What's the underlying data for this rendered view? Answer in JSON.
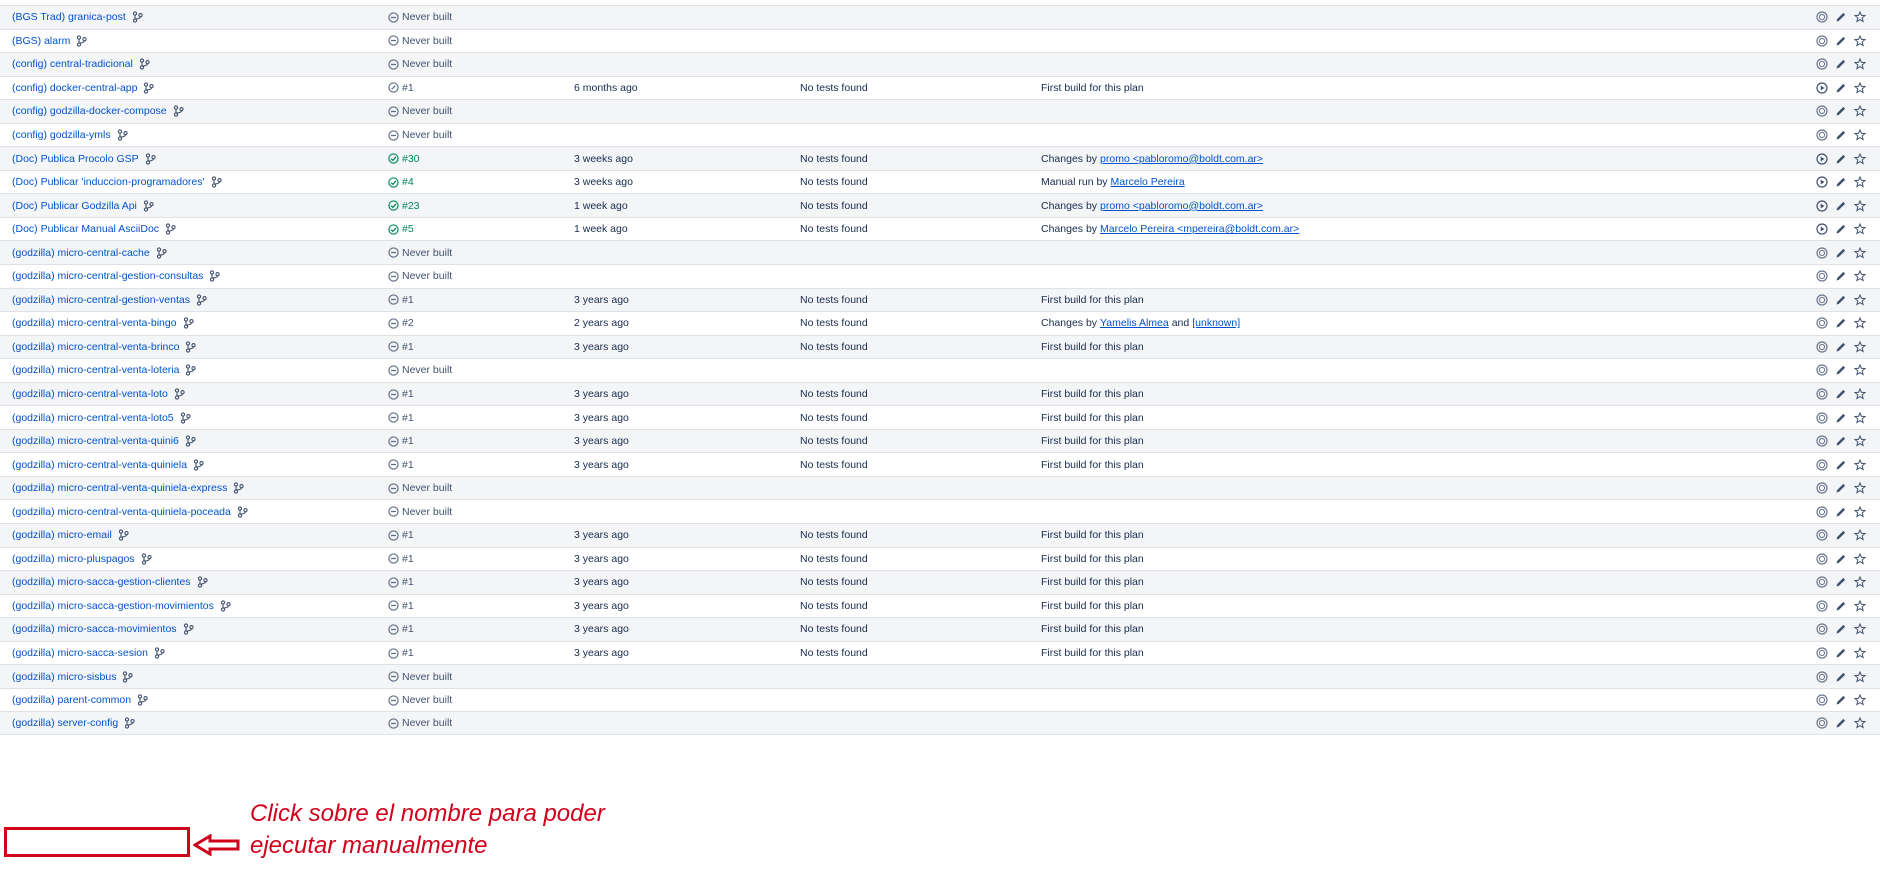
{
  "plans": [
    {
      "name": "(BGS Trad) granica-post",
      "status_icon": "minus-circle-icon",
      "status": "Never built",
      "time": "",
      "tests": "",
      "reason": [],
      "run_icon": "run-disabled-icon"
    },
    {
      "name": "(BGS) alarm",
      "status_icon": "minus-circle-icon",
      "status": "Never built",
      "time": "",
      "tests": "",
      "reason": [],
      "run_icon": "run-disabled-icon"
    },
    {
      "name": "(config) central-tradicional",
      "status_icon": "minus-circle-icon",
      "status": "Never built",
      "time": "",
      "tests": "",
      "reason": [],
      "run_icon": "run-disabled-icon"
    },
    {
      "name": "(config) docker-central-app",
      "status_icon": "unknown-circle-icon",
      "status": "#1",
      "time": "6 months ago",
      "tests": "No tests found",
      "reason": [
        {
          "t": "First build for this plan"
        }
      ],
      "run_icon": "run-icon"
    },
    {
      "name": "(config) godzilla-docker-compose",
      "status_icon": "minus-circle-icon",
      "status": "Never built",
      "time": "",
      "tests": "",
      "reason": [],
      "run_icon": "run-disabled-icon"
    },
    {
      "name": "(config) godzilla-ymls",
      "status_icon": "minus-circle-icon",
      "status": "Never built",
      "time": "",
      "tests": "",
      "reason": [],
      "run_icon": "run-disabled-icon"
    },
    {
      "name": "(Doc) Publica Procolo GSP",
      "status_icon": "check-circle-icon",
      "status": "#30",
      "time": "3 weeks ago",
      "tests": "No tests found",
      "reason": [
        {
          "t": "Changes by"
        },
        {
          "t": "promo <pabloromo@boldt.com.ar>",
          "link": true
        }
      ],
      "run_icon": "run-icon"
    },
    {
      "name": "(Doc) Publicar 'induccion-programadores'",
      "status_icon": "check-circle-icon",
      "status": "#4",
      "time": "3 weeks ago",
      "tests": "No tests found",
      "reason": [
        {
          "t": "Manual run by"
        },
        {
          "t": "Marcelo Pereira",
          "link": true
        }
      ],
      "run_icon": "run-icon"
    },
    {
      "name": "(Doc) Publicar Godzilla Api",
      "status_icon": "check-circle-icon",
      "status": "#23",
      "time": "1 week ago",
      "tests": "No tests found",
      "reason": [
        {
          "t": "Changes by"
        },
        {
          "t": "promo <pabloromo@boldt.com.ar>",
          "link": true
        }
      ],
      "run_icon": "run-icon"
    },
    {
      "name": "(Doc) Publicar Manual AsciiDoc",
      "status_icon": "check-circle-icon",
      "status": "#5",
      "time": "1 week ago",
      "tests": "No tests found",
      "reason": [
        {
          "t": "Changes by"
        },
        {
          "t": "Marcelo Pereira <mpereira@boldt.com.ar>",
          "link": true
        }
      ],
      "run_icon": "run-icon"
    },
    {
      "name": "(godzilla) micro-central-cache",
      "status_icon": "minus-circle-icon",
      "status": "Never built",
      "time": "",
      "tests": "",
      "reason": [],
      "run_icon": "run-disabled-icon"
    },
    {
      "name": "(godzilla) micro-central-gestion-consultas",
      "status_icon": "minus-circle-icon",
      "status": "Never built",
      "time": "",
      "tests": "",
      "reason": [],
      "run_icon": "run-disabled-icon"
    },
    {
      "name": "(godzilla) micro-central-gestion-ventas",
      "status_icon": "minus-circle-icon",
      "status": "#1",
      "time": "3 years ago",
      "tests": "No tests found",
      "reason": [
        {
          "t": "First build for this plan"
        }
      ],
      "run_icon": "run-disabled-icon"
    },
    {
      "name": "(godzilla) micro-central-venta-bingo",
      "status_icon": "minus-circle-icon",
      "status": "#2",
      "time": "2 years ago",
      "tests": "No tests found",
      "reason": [
        {
          "t": "Changes by"
        },
        {
          "t": "Yamelis Almea",
          "link": true
        },
        {
          "t": "and"
        },
        {
          "t": "[unknown]",
          "link": true
        }
      ],
      "run_icon": "run-disabled-icon"
    },
    {
      "name": "(godzilla) micro-central-venta-brinco",
      "status_icon": "minus-circle-icon",
      "status": "#1",
      "time": "3 years ago",
      "tests": "No tests found",
      "reason": [
        {
          "t": "First build for this plan"
        }
      ],
      "run_icon": "run-disabled-icon"
    },
    {
      "name": "(godzilla) micro-central-venta-loteria",
      "status_icon": "minus-circle-icon",
      "status": "Never built",
      "time": "",
      "tests": "",
      "reason": [],
      "run_icon": "run-disabled-icon"
    },
    {
      "name": "(godzilla) micro-central-venta-loto",
      "status_icon": "minus-circle-icon",
      "status": "#1",
      "time": "3 years ago",
      "tests": "No tests found",
      "reason": [
        {
          "t": "First build for this plan"
        }
      ],
      "run_icon": "run-disabled-icon"
    },
    {
      "name": "(godzilla) micro-central-venta-loto5",
      "status_icon": "minus-circle-icon",
      "status": "#1",
      "time": "3 years ago",
      "tests": "No tests found",
      "reason": [
        {
          "t": "First build for this plan"
        }
      ],
      "run_icon": "run-disabled-icon"
    },
    {
      "name": "(godzilla) micro-central-venta-quini6",
      "status_icon": "minus-circle-icon",
      "status": "#1",
      "time": "3 years ago",
      "tests": "No tests found",
      "reason": [
        {
          "t": "First build for this plan"
        }
      ],
      "run_icon": "run-disabled-icon"
    },
    {
      "name": "(godzilla) micro-central-venta-quiniela",
      "status_icon": "minus-circle-icon",
      "status": "#1",
      "time": "3 years ago",
      "tests": "No tests found",
      "reason": [
        {
          "t": "First build for this plan"
        }
      ],
      "run_icon": "run-disabled-icon"
    },
    {
      "name": "(godzilla) micro-central-venta-quiniela-express",
      "status_icon": "minus-circle-icon",
      "status": "Never built",
      "time": "",
      "tests": "",
      "reason": [],
      "run_icon": "run-disabled-icon"
    },
    {
      "name": "(godzilla) micro-central-venta-quiniela-poceada",
      "status_icon": "minus-circle-icon",
      "status": "Never built",
      "time": "",
      "tests": "",
      "reason": [],
      "run_icon": "run-disabled-icon"
    },
    {
      "name": "(godzilla) micro-email",
      "status_icon": "minus-circle-icon",
      "status": "#1",
      "time": "3 years ago",
      "tests": "No tests found",
      "reason": [
        {
          "t": "First build for this plan"
        }
      ],
      "run_icon": "run-disabled-icon"
    },
    {
      "name": "(godzilla) micro-pluspagos",
      "status_icon": "minus-circle-icon",
      "status": "#1",
      "time": "3 years ago",
      "tests": "No tests found",
      "reason": [
        {
          "t": "First build for this plan"
        }
      ],
      "run_icon": "run-disabled-icon"
    },
    {
      "name": "(godzilla) micro-sacca-gestion-clientes",
      "status_icon": "minus-circle-icon",
      "status": "#1",
      "time": "3 years ago",
      "tests": "No tests found",
      "reason": [
        {
          "t": "First build for this plan"
        }
      ],
      "run_icon": "run-disabled-icon"
    },
    {
      "name": "(godzilla) micro-sacca-gestion-movimientos",
      "status_icon": "minus-circle-icon",
      "status": "#1",
      "time": "3 years ago",
      "tests": "No tests found",
      "reason": [
        {
          "t": "First build for this plan"
        }
      ],
      "run_icon": "run-disabled-icon"
    },
    {
      "name": "(godzilla) micro-sacca-movimientos",
      "status_icon": "minus-circle-icon",
      "status": "#1",
      "time": "3 years ago",
      "tests": "No tests found",
      "reason": [
        {
          "t": "First build for this plan"
        }
      ],
      "run_icon": "run-disabled-icon"
    },
    {
      "name": "(godzilla) micro-sacca-sesion",
      "status_icon": "minus-circle-icon",
      "status": "#1",
      "time": "3 years ago",
      "tests": "No tests found",
      "reason": [
        {
          "t": "First build for this plan"
        }
      ],
      "run_icon": "run-disabled-icon"
    },
    {
      "name": "(godzilla) micro-sisbus",
      "status_icon": "minus-circle-icon",
      "status": "Never built",
      "time": "",
      "tests": "",
      "reason": [],
      "run_icon": "run-disabled-icon"
    },
    {
      "name": "(godzilla) parent-common",
      "status_icon": "minus-circle-icon",
      "status": "Never built",
      "time": "",
      "tests": "",
      "reason": [],
      "run_icon": "run-disabled-icon"
    },
    {
      "name": "(godzilla) server-config",
      "status_icon": "minus-circle-icon",
      "status": "Never built",
      "time": "",
      "tests": "",
      "reason": [],
      "run_icon": "run-disabled-icon"
    }
  ],
  "annotation": {
    "line1": "Click sobre el nombre para poder",
    "line2": "ejecutar manualmente"
  },
  "colors": {
    "link": "#0052cc",
    "success": "#00875a",
    "annotation": "#d0021b"
  }
}
